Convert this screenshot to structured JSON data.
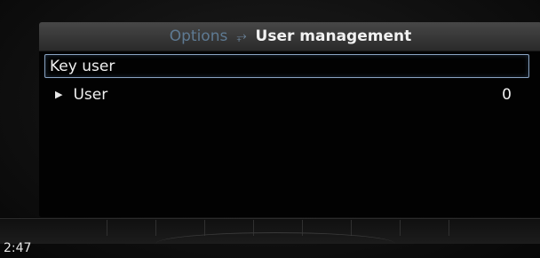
{
  "header": {
    "parent": "Options",
    "current": "User management"
  },
  "list": {
    "items": [
      {
        "label": "Key user",
        "value": "",
        "selected": true
      },
      {
        "label": "User",
        "value": "0",
        "expandable": true
      }
    ]
  },
  "status": {
    "clock": "2:47"
  },
  "colors": {
    "accent": "#8aa4c2",
    "breadcrumb_parent": "#5e7a93"
  },
  "icons": {
    "breadcrumb_separator": "back-arrow-icon",
    "expand": "triangle-right-icon"
  }
}
